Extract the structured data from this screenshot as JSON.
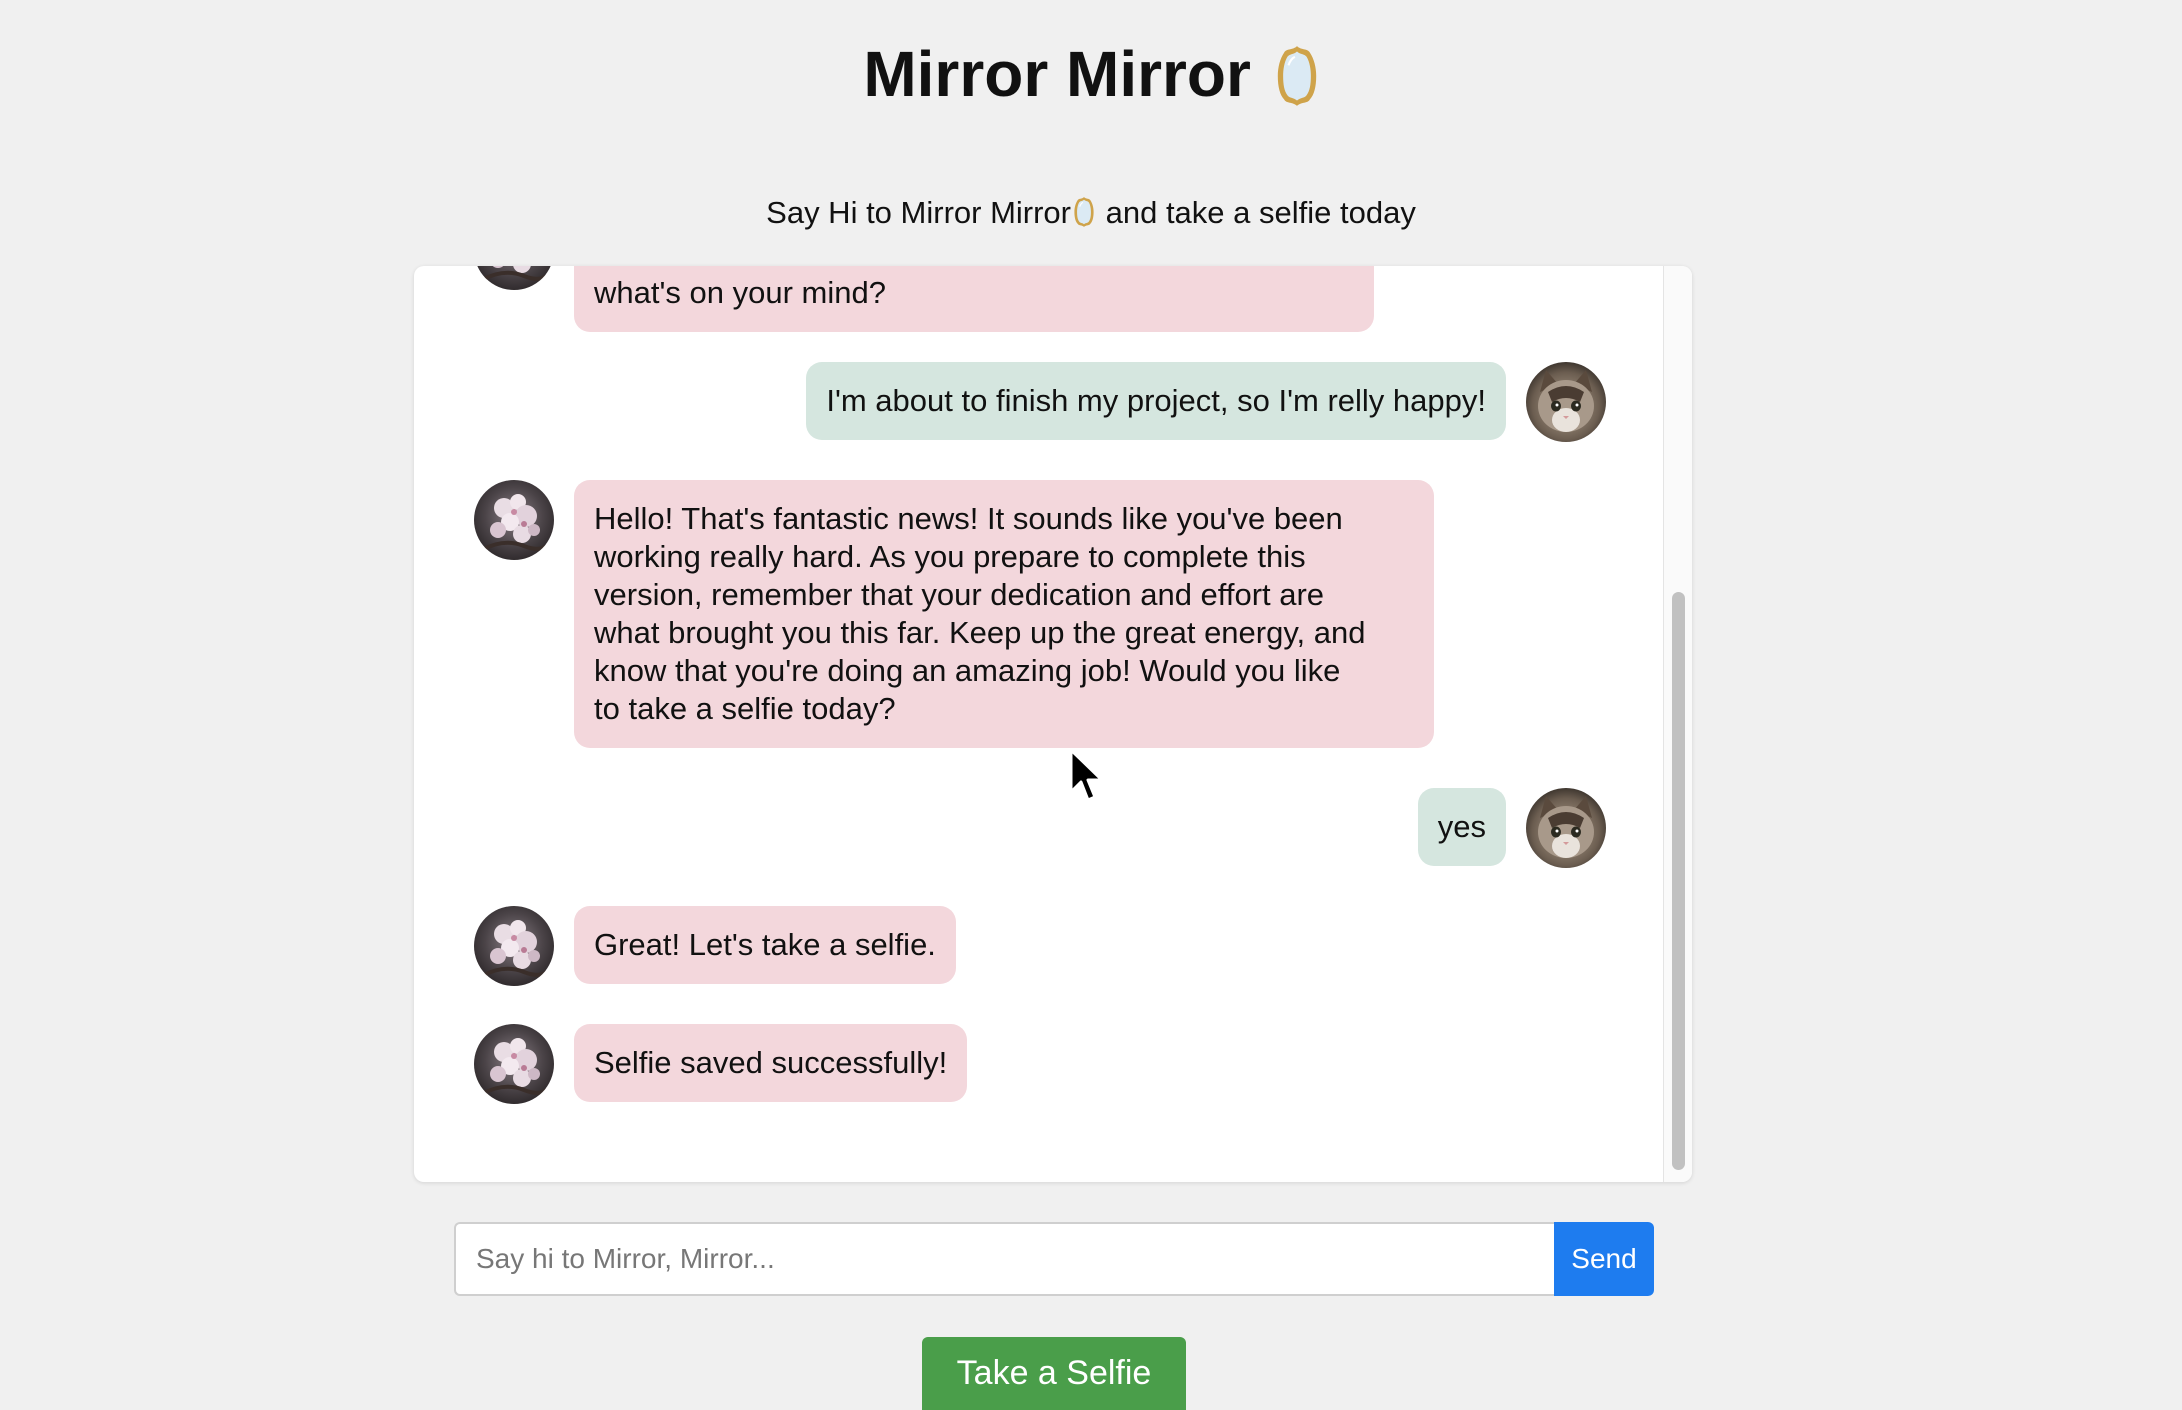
{
  "header": {
    "title": "Mirror Mirror",
    "title_icon": "mirror-icon",
    "subtitle_before": "Say Hi to Mirror Mirror",
    "subtitle_after": " and take a selfie today"
  },
  "chat": {
    "messages": [
      {
        "sender": "bot",
        "avatar": "cherry-blossom-avatar",
        "text": "what's on your mind?"
      },
      {
        "sender": "user",
        "avatar": "cat-avatar",
        "text": "I'm about to finish my project, so I'm relly happy!"
      },
      {
        "sender": "bot",
        "avatar": "cherry-blossom-avatar",
        "lines": [
          "Hello! That's fantastic news! It sounds like you've been",
          "working really hard. As you prepare to complete this",
          "version, remember that your dedication and effort are",
          "what brought you this far. Keep up the great energy, and",
          "know that you're doing an amazing job! Would you like",
          "to take a selfie today?"
        ]
      },
      {
        "sender": "user",
        "avatar": "cat-avatar",
        "text": "yes"
      },
      {
        "sender": "bot",
        "avatar": "cherry-blossom-avatar",
        "text": "Great! Let's take a selfie."
      },
      {
        "sender": "bot",
        "avatar": "cherry-blossom-avatar",
        "text": "Selfie saved successfully!"
      }
    ]
  },
  "input": {
    "placeholder": "Say hi to Mirror, Mirror...",
    "value": "",
    "send_label": "Send"
  },
  "actions": {
    "selfie_label": "Take a Selfie"
  },
  "colors": {
    "page_bg": "#f0f0f0",
    "bot_bubble": "#f3d7dc",
    "user_bubble": "#d5e6df",
    "send_button": "#1e7cef",
    "selfie_button": "#4a9e4a"
  }
}
